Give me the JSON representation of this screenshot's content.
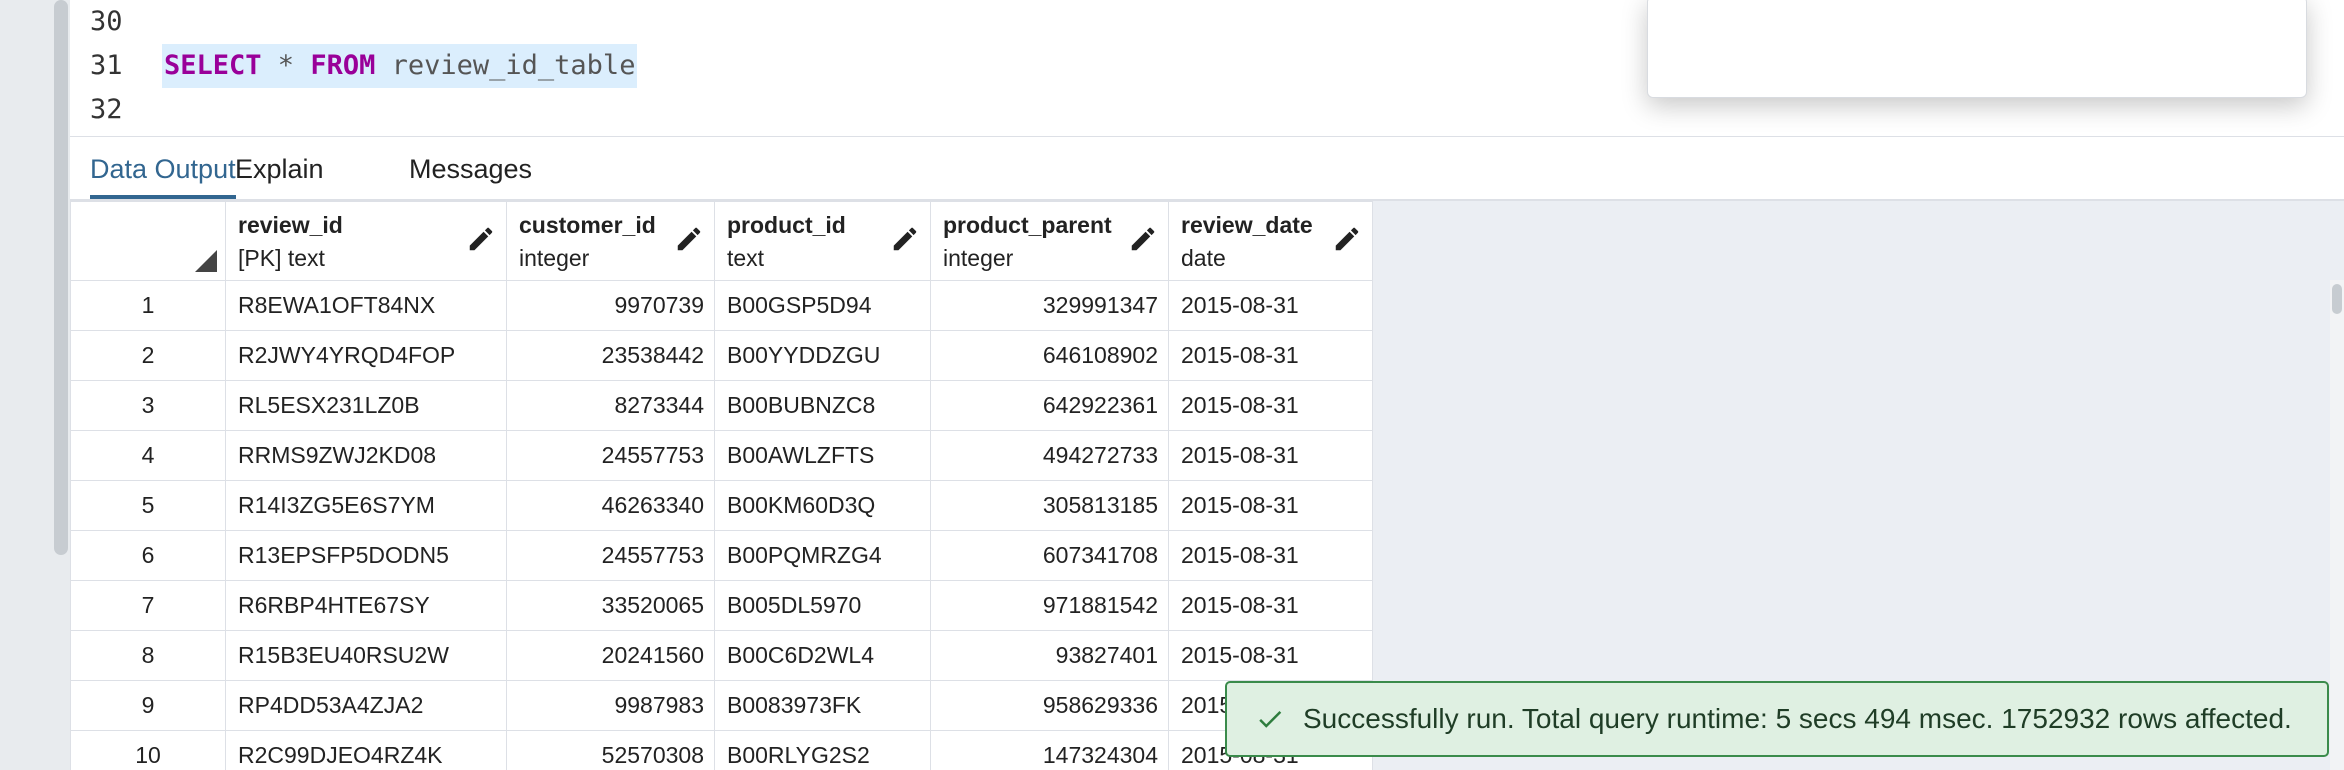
{
  "editor": {
    "lines": [
      {
        "number": "30",
        "code": ""
      },
      {
        "number": "31",
        "keyword1": "SELECT",
        "star": " * ",
        "keyword2": "FROM",
        "table": " review_id_table"
      },
      {
        "number": "32",
        "code": ""
      }
    ]
  },
  "tabs": [
    "Data Output",
    "Explain",
    "Messages"
  ],
  "active_tab": "Data Output",
  "columns": [
    {
      "name": "review_id",
      "type": "[PK] text"
    },
    {
      "name": "customer_id",
      "type": "integer"
    },
    {
      "name": "product_id",
      "type": "text"
    },
    {
      "name": "product_parent",
      "type": "integer"
    },
    {
      "name": "review_date",
      "type": "date"
    }
  ],
  "rows": [
    [
      "1",
      "R8EWA1OFT84NX",
      "9970739",
      "B00GSP5D94",
      "329991347",
      "2015-08-31"
    ],
    [
      "2",
      "R2JWY4YRQD4FOP",
      "23538442",
      "B00YYDDZGU",
      "646108902",
      "2015-08-31"
    ],
    [
      "3",
      "RL5ESX231LZ0B",
      "8273344",
      "B00BUBNZC8",
      "642922361",
      "2015-08-31"
    ],
    [
      "4",
      "RRMS9ZWJ2KD08",
      "24557753",
      "B00AWLZFTS",
      "494272733",
      "2015-08-31"
    ],
    [
      "5",
      "R14I3ZG5E6S7YM",
      "46263340",
      "B00KM60D3Q",
      "305813185",
      "2015-08-31"
    ],
    [
      "6",
      "R13EPSFP5DODN5",
      "24557753",
      "B00PQMRZG4",
      "607341708",
      "2015-08-31"
    ],
    [
      "7",
      "R6RBP4HTE67SY",
      "33520065",
      "B005DL5970",
      "971881542",
      "2015-08-31"
    ],
    [
      "8",
      "R15B3EU40RSU2W",
      "20241560",
      "B00C6D2WL4",
      "93827401",
      "2015-08-31"
    ],
    [
      "9",
      "RP4DD53A4ZJA2",
      "9987983",
      "B0083973FK",
      "958629336",
      "2015-08-31"
    ],
    [
      "10",
      "R2C99DJEO4RZ4K",
      "52570308",
      "B00RLYG2S2",
      "147324304",
      "2015-08-31"
    ]
  ],
  "toast": {
    "message": "Successfully run. Total query runtime: 5 secs 494 msec. 1752932 rows affected.",
    "icon": "checkmark-icon"
  },
  "colors": {
    "keyword": "#990099",
    "active_tab": "#326690",
    "toast_bg": "#dff0e2",
    "toast_border": "#3a8b4b"
  }
}
